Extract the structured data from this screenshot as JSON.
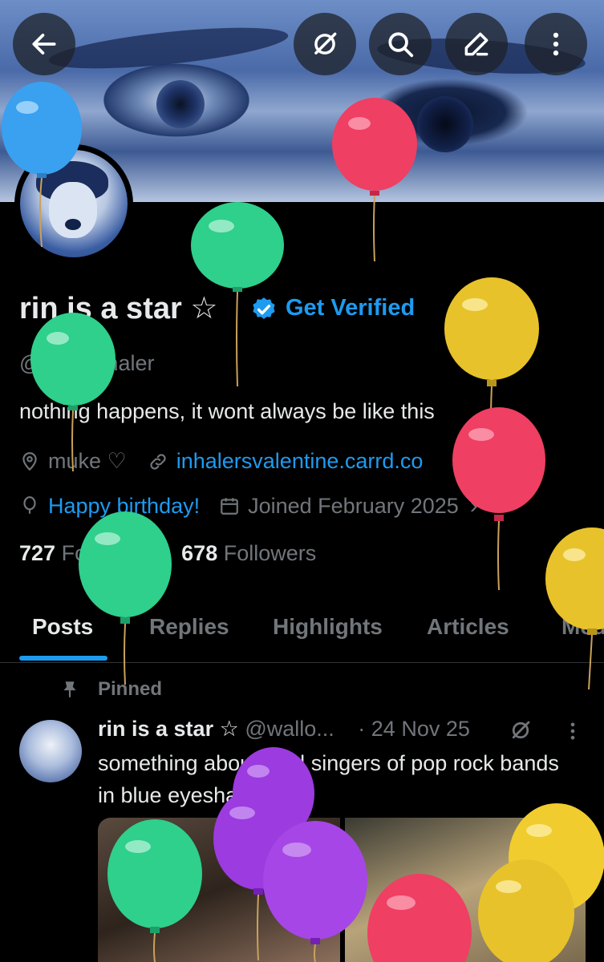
{
  "profile": {
    "display_name": "rin is a star",
    "name_star": "☆",
    "get_verified": "Get Verified",
    "handle": "@wallowhaler",
    "bio": "nothing happens, it wont always be like this",
    "location": "muke ♡",
    "website": "inhalersvalentine.carrd.co",
    "birthday": "Happy birthday!",
    "joined": "Joined February 2025",
    "following_count": "727",
    "following_label": "Following",
    "followers_count": "678",
    "followers_label": "Followers"
  },
  "tabs": [
    {
      "label": "Posts",
      "active": true
    },
    {
      "label": "Replies"
    },
    {
      "label": "Highlights"
    },
    {
      "label": "Articles"
    },
    {
      "label": "Media"
    }
  ],
  "pinned_post": {
    "pinned_label": "Pinned",
    "author_name": "rin is a star",
    "author_star": "☆",
    "author_handle": "@wallo...",
    "date": "· 24 Nov 25",
    "text": "something about lead singers of pop rock bands in blue eyeshadow..."
  },
  "icons": [
    "back-arrow-icon",
    "grok-icon",
    "search-icon",
    "edit-icon",
    "more-icon",
    "verified-badge-icon",
    "location-icon",
    "link-icon",
    "balloon-icon",
    "calendar-icon",
    "pin-icon"
  ],
  "colors": {
    "accent": "#1d9bf0",
    "muted": "#71767b",
    "text": "#e7e9ea",
    "background": "#000000"
  }
}
